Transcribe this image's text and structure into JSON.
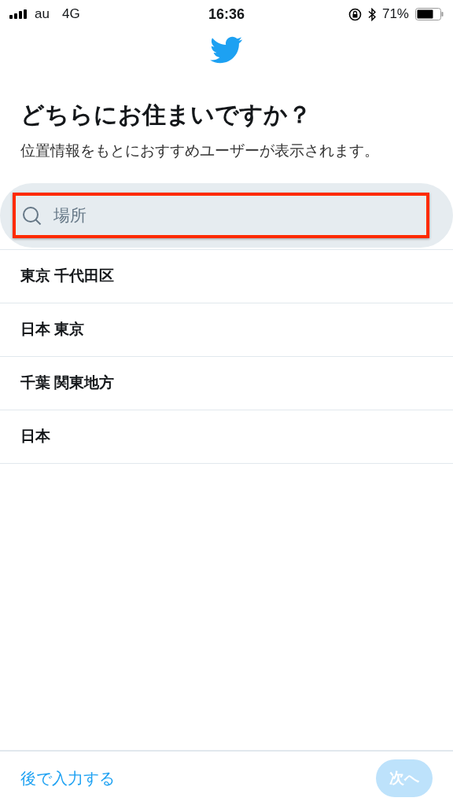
{
  "status_bar": {
    "carrier": "au",
    "network": "4G",
    "time": "16:36",
    "battery": "71%"
  },
  "title": "どちらにお住まいですか？",
  "subtitle": "位置情報をもとにおすすめユーザーが表示されます。",
  "search": {
    "placeholder": "場所",
    "highlighted": true
  },
  "locations": [
    {
      "label": "東京 千代田区"
    },
    {
      "label": "日本 東京"
    },
    {
      "label": "千葉 関東地方"
    },
    {
      "label": "日本"
    }
  ],
  "footer": {
    "skip_link": "後で入力する",
    "next_button": {
      "label": "次へ",
      "disabled": true
    }
  }
}
